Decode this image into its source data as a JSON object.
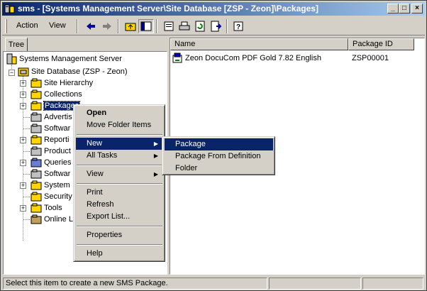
{
  "window": {
    "title": "sms - [Systems Management Server\\Site Database [ZSP - Zeon]\\Packages]",
    "minimize": "_",
    "maximize": "□",
    "close": "×"
  },
  "menubar": {
    "action": "Action",
    "view": "View"
  },
  "toolbar": {
    "icons": [
      "back-icon",
      "forward-icon",
      "up-folder-icon",
      "show-tree-icon",
      "properties-icon",
      "print-icon",
      "refresh-icon",
      "export-list-icon",
      "help-icon"
    ]
  },
  "tree_tab": "Tree",
  "tree": {
    "root": "Systems Management Server",
    "site_db": "Site Database (ZSP - Zeon)",
    "items": [
      {
        "label": "Site Hierarchy"
      },
      {
        "label": "Collections"
      },
      {
        "label": "Packages"
      },
      {
        "label": "Advertis"
      },
      {
        "label": "Softwar"
      },
      {
        "label": "Reporti"
      },
      {
        "label": "Product"
      },
      {
        "label": "Queries"
      },
      {
        "label": "Softwar"
      },
      {
        "label": "System"
      },
      {
        "label": "Security"
      },
      {
        "label": "Tools"
      },
      {
        "label": "Online L"
      }
    ]
  },
  "list": {
    "columns": [
      "Name",
      "Package ID"
    ],
    "rows": [
      {
        "name": "Zeon DocuCom PDF Gold 7.82 English",
        "package_id": "ZSP00001"
      }
    ]
  },
  "context_menu": {
    "open": "Open",
    "move": "Move Folder Items",
    "new": "New",
    "all_tasks": "All Tasks",
    "view": "View",
    "print": "Print",
    "refresh": "Refresh",
    "export": "Export List...",
    "properties": "Properties",
    "help": "Help"
  },
  "submenu": {
    "package": "Package",
    "from_definition": "Package From Definition",
    "folder": "Folder"
  },
  "status": {
    "text": "Select this item to create a new SMS Package."
  },
  "colors": {
    "selection": "#0a246a",
    "face": "#d4d0c8"
  }
}
